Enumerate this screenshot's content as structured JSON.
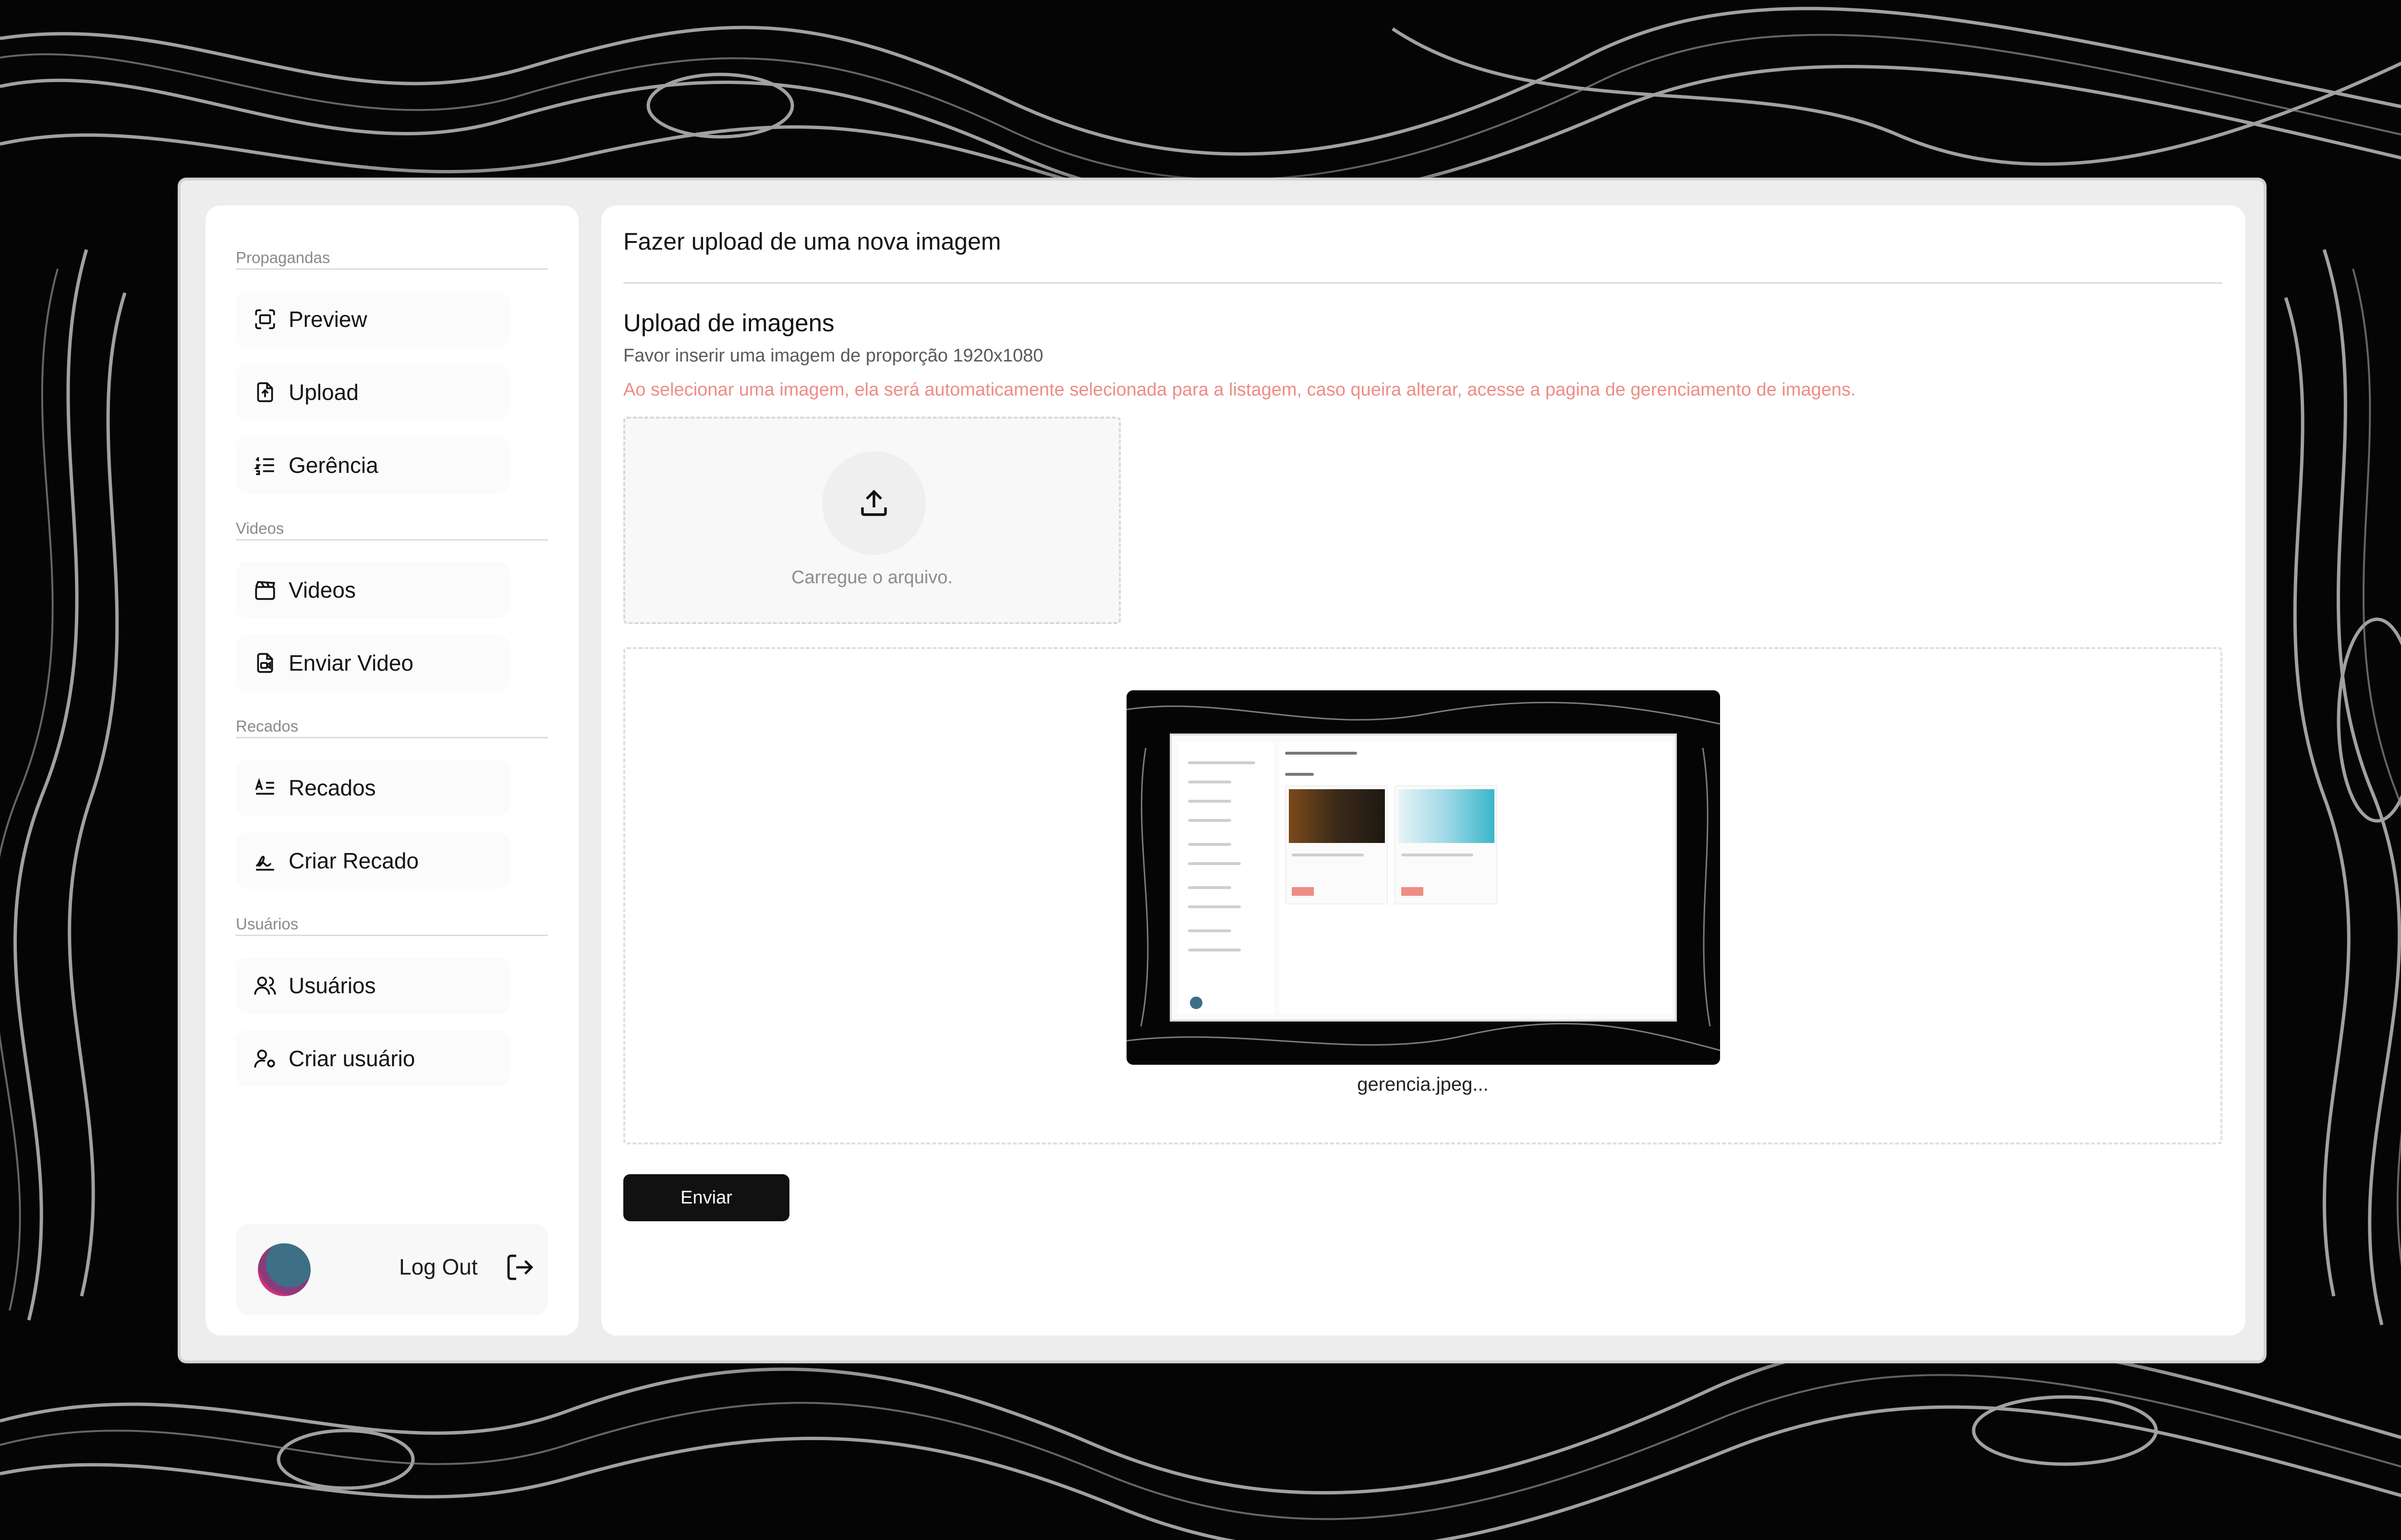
{
  "sidebar": {
    "sections": [
      {
        "title": "Propagandas",
        "items": [
          {
            "label": "Preview",
            "icon": "preview-icon"
          },
          {
            "label": "Upload",
            "icon": "file-upload-icon"
          },
          {
            "label": "Gerência",
            "icon": "list-icon"
          }
        ]
      },
      {
        "title": "Videos",
        "items": [
          {
            "label": "Videos",
            "icon": "clapperboard-icon"
          },
          {
            "label": "Enviar Video",
            "icon": "file-video-icon"
          }
        ]
      },
      {
        "title": "Recados",
        "items": [
          {
            "label": "Recados",
            "icon": "text-align-icon"
          },
          {
            "label": "Criar Recado",
            "icon": "signature-icon"
          }
        ]
      },
      {
        "title": "Usuários",
        "items": [
          {
            "label": "Usuários",
            "icon": "users-icon"
          },
          {
            "label": "Criar usuário",
            "icon": "user-cog-icon"
          }
        ]
      }
    ],
    "logout_label": "Log Out"
  },
  "main": {
    "title": "Fazer upload de uma nova imagem",
    "section_title": "Upload de imagens",
    "subtitle": "Favor inserir uma imagem de proporção 1920x1080",
    "warning": "Ao selecionar uma imagem, ela será automaticamente selecionada para a listagem, caso queira alterar, acesse a pagina de gerenciamento de imagens.",
    "dropzone_label": "Carregue o arquivo.",
    "file_name": "gerencia.jpeg...",
    "submit_label": "Enviar"
  },
  "colors": {
    "warning": "#ee8c86",
    "button": "#111111",
    "background": "#050505"
  }
}
